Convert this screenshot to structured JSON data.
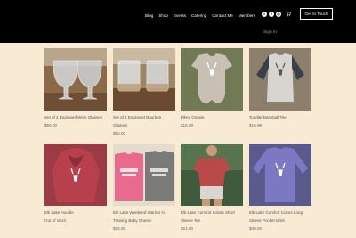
{
  "nav": {
    "items": [
      "Blog",
      "Shop",
      "Events",
      "Catering",
      "Contact Me",
      "Members"
    ],
    "cta": "Get In Touch",
    "signin": "Sign In"
  },
  "socials": [
    {
      "icon": "twitter-icon",
      "glyph": "t"
    },
    {
      "icon": "facebook-icon",
      "glyph": "f"
    },
    {
      "icon": "instagram-icon",
      "glyph": "◎"
    }
  ],
  "products": [
    {
      "name": "Set of 2 Engraved Wine Glasses",
      "price": "$50.00"
    },
    {
      "name": "Set of 2 Engraved Bourbon Glasses",
      "price": "$50.00"
    },
    {
      "name": "Elkey Onesie",
      "price": "$15.00"
    },
    {
      "name": "Toddler Baseball Tee",
      "price": "$16.99"
    },
    {
      "name": "Elk Lake Hoodie",
      "price": "Out of stock"
    },
    {
      "name": "Elk Lake Weekend Warrior in Training Baby Onesie",
      "price": "$15.00"
    },
    {
      "name": "Elk Lake Comfort Colors Short Sleeve Tee",
      "price": "$21.00"
    },
    {
      "name": "Elk Lake Comfort Colors Long Sleeve Pocket tshirt",
      "price": "$39.00"
    }
  ]
}
